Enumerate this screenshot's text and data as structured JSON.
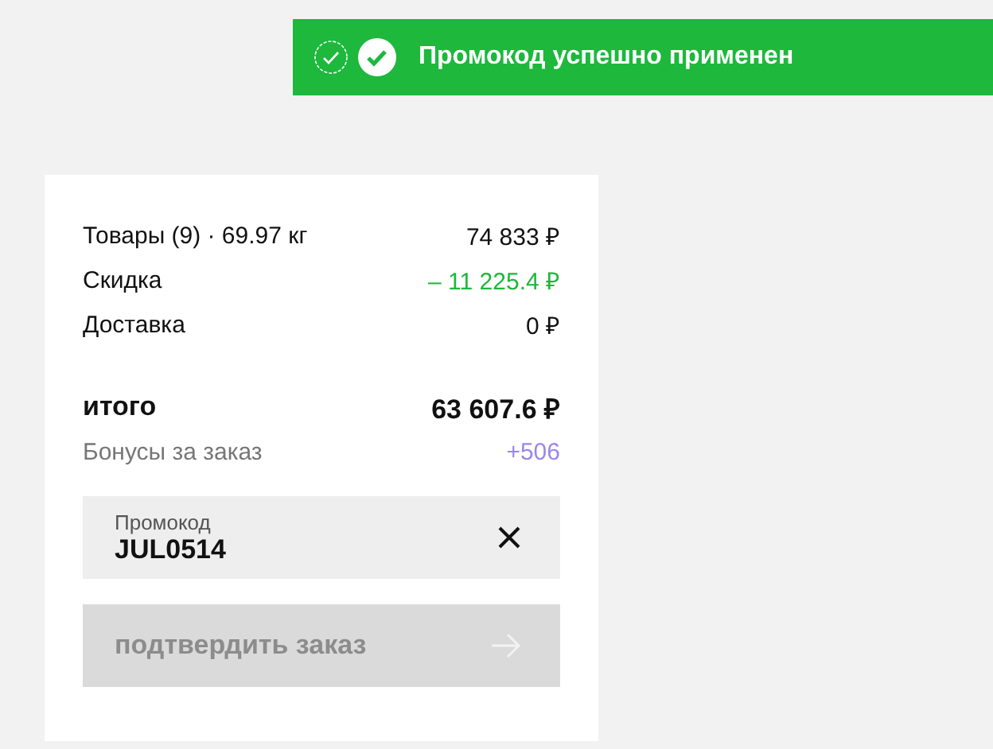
{
  "toast": {
    "message": "Промокод успешно применен"
  },
  "summary": [
    {
      "kind": "normal",
      "label": "Товары (9) · 69.97 кг",
      "value": "74 833 ₽"
    },
    {
      "kind": "discount",
      "label": "Скидка",
      "value": "– 11 225.4 ₽"
    },
    {
      "kind": "normal",
      "label": "Доставка",
      "value": "0 ₽"
    },
    {
      "kind": "total",
      "label": "итого",
      "value": "63 607.6 ₽"
    },
    {
      "kind": "bonus",
      "label": "Бонусы за заказ",
      "value": "+506"
    }
  ],
  "promo": {
    "label": "Промокод",
    "value": "JUL0514"
  },
  "confirm_button": {
    "label": "подтвердить заказ",
    "disabled": true
  }
}
